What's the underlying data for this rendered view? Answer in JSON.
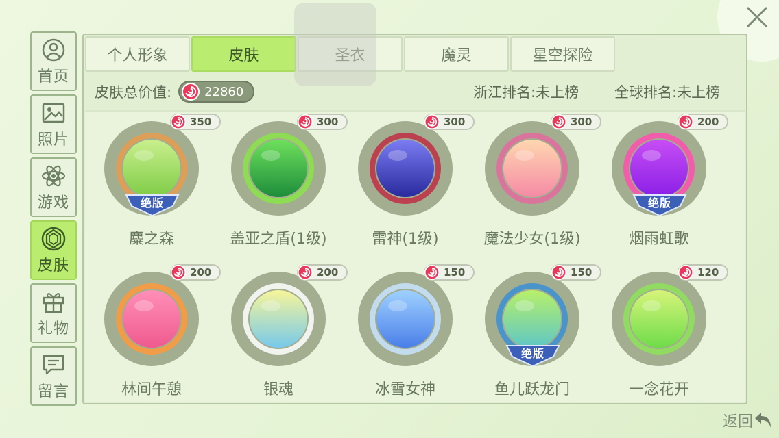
{
  "window": {
    "close_icon": "close-icon"
  },
  "sidebar": {
    "items": [
      {
        "label": "首页",
        "icon": "user-icon"
      },
      {
        "label": "照片",
        "icon": "photo-icon"
      },
      {
        "label": "游戏",
        "icon": "atom-icon"
      },
      {
        "label": "皮肤",
        "icon": "skin-icon",
        "active": true
      },
      {
        "label": "礼物",
        "icon": "gift-icon"
      },
      {
        "label": "留言",
        "icon": "message-icon"
      }
    ]
  },
  "tabs": [
    {
      "label": "个人形象"
    },
    {
      "label": "皮肤",
      "active": true
    },
    {
      "label": "圣衣"
    },
    {
      "label": "魔灵"
    },
    {
      "label": "星空探险"
    }
  ],
  "info": {
    "total_label": "皮肤总价值:",
    "total_value": "22860",
    "rank_province": "浙江排名:未上榜",
    "rank_global": "全球排名:未上榜"
  },
  "skins": [
    {
      "name": "麋之森",
      "price": "350",
      "badge": "绝版",
      "colors": [
        "#c9ef8d",
        "#7fcc47"
      ],
      "ring": "#e89b4f"
    },
    {
      "name": "盖亚之盾(1级)",
      "price": "300",
      "badge": "",
      "colors": [
        "#6ee05c",
        "#1d8d3b"
      ],
      "ring": "#8ae44a"
    },
    {
      "name": "雷神(1级)",
      "price": "300",
      "badge": "",
      "colors": [
        "#7c7cf3",
        "#2a2a9e"
      ],
      "ring": "#c02e45"
    },
    {
      "name": "魔法少女(1级)",
      "price": "300",
      "badge": "",
      "colors": [
        "#ffd7b0",
        "#f58aa5"
      ],
      "ring": "#e56aa0"
    },
    {
      "name": "烟雨虹歌",
      "price": "200",
      "badge": "绝版",
      "colors": [
        "#c74ef5",
        "#8a1fe6"
      ],
      "ring": "#ff4fb0"
    },
    {
      "name": "林间午憩",
      "price": "200",
      "badge": "",
      "colors": [
        "#ff8fb8",
        "#ef5a8e"
      ],
      "ring": "#ff9a3c"
    },
    {
      "name": "银魂",
      "price": "200",
      "badge": "",
      "colors": [
        "#f7f59a",
        "#77c9ea"
      ],
      "ring": "#ffffff"
    },
    {
      "name": "冰雪女神",
      "price": "150",
      "badge": "",
      "colors": [
        "#9fd1ff",
        "#4a7fe8"
      ],
      "ring": "#c8e4ff"
    },
    {
      "name": "鱼儿跃龙门",
      "price": "150",
      "badge": "绝版",
      "colors": [
        "#b8f06a",
        "#5fc7c5"
      ],
      "ring": "#3a8fd6"
    },
    {
      "name": "一念花开",
      "price": "120",
      "badge": "",
      "colors": [
        "#d6f47a",
        "#6fdc4a"
      ],
      "ring": "#8fe35a"
    }
  ],
  "footer": {
    "back_label": "返回"
  },
  "colors": {
    "accent": "#b9ec6f",
    "coin": "#e8395b"
  }
}
